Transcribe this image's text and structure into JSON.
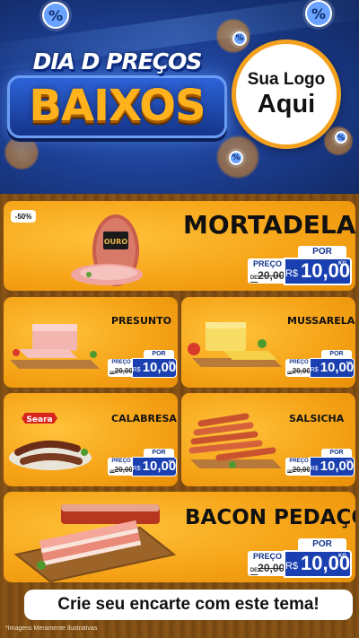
{
  "header": {
    "title_top": "DIA D PREÇOS",
    "title_main": "BAIXOS",
    "logo_line1": "Sua Logo",
    "logo_line2": "Aqui",
    "badge_symbol": "%"
  },
  "colors": {
    "header_blue": "#1d3f93",
    "card_orange": "#f6a418",
    "price_blue": "#1a3fb0",
    "accent_gold": "#ffb21c"
  },
  "products": [
    {
      "name": "MORTADELA",
      "discount": "-50%",
      "price_label": "PREÇO",
      "old_prefix": "DE",
      "old_price": "20,00",
      "por": "POR",
      "currency": "R$",
      "price": "10,00",
      "unit": "KG",
      "brand": "OURO"
    },
    {
      "name": "PRESUNTO",
      "price_label": "PREÇO",
      "old_prefix": "DE",
      "old_price": "20,00",
      "por": "POR",
      "currency": "R$",
      "price": "10,00",
      "unit": "KG"
    },
    {
      "name": "MUSSARELA",
      "price_label": "PREÇO",
      "old_prefix": "DE",
      "old_price": "20,00",
      "por": "POR",
      "currency": "R$",
      "price": "10,00",
      "unit": "KG"
    },
    {
      "name": "CALABRESA",
      "price_label": "PREÇO",
      "old_prefix": "DE",
      "old_price": "20,00",
      "por": "POR",
      "currency": "R$",
      "price": "10,00",
      "unit": "KG",
      "brand": "Seara"
    },
    {
      "name": "SALSICHA",
      "price_label": "PREÇO",
      "old_prefix": "DE",
      "old_price": "20,00",
      "por": "POR",
      "currency": "R$",
      "price": "10,00",
      "unit": "KG"
    },
    {
      "name": "BACON PEDAÇO",
      "price_label": "PREÇO",
      "old_prefix": "DE",
      "old_price": "20,00",
      "por": "POR",
      "currency": "R$",
      "price": "10,00",
      "unit": "KG"
    }
  ],
  "footer": {
    "cta": "Crie seu encarte com este tema!",
    "disclaimer": "*Imagens Meramente Ilustrativas"
  }
}
